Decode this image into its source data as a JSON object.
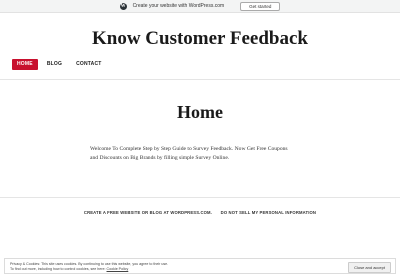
{
  "wpbar": {
    "message": "Create your website with WordPress.com",
    "button": "Get started"
  },
  "site": {
    "title": "Know Customer Feedback"
  },
  "nav": {
    "items": [
      {
        "label": "HOME",
        "active": true
      },
      {
        "label": "BLOG",
        "active": false
      },
      {
        "label": "CONTACT",
        "active": false
      }
    ],
    "active_color": "#c8102e"
  },
  "page": {
    "title": "Home",
    "content_line1": "Welcome To Complete Step by Step Guide to Survey Feedback. Now Get Free Coupons",
    "content_line2": "and Discounts on Big Brands by filling simple Survey Online."
  },
  "footer": {
    "link1": "CREATE A FREE WEBSITE OR BLOG AT WORDPRESS.COM.",
    "link2": "DO NOT SELL MY PERSONAL INFORMATION"
  },
  "cookie": {
    "line1": "Privacy & Cookies: This site uses cookies. By continuing to use this website, you agree to their use.",
    "line2": "To find out more, including how to control cookies, see here:",
    "policy_link": "Cookie Policy",
    "button": "Close and accept"
  }
}
